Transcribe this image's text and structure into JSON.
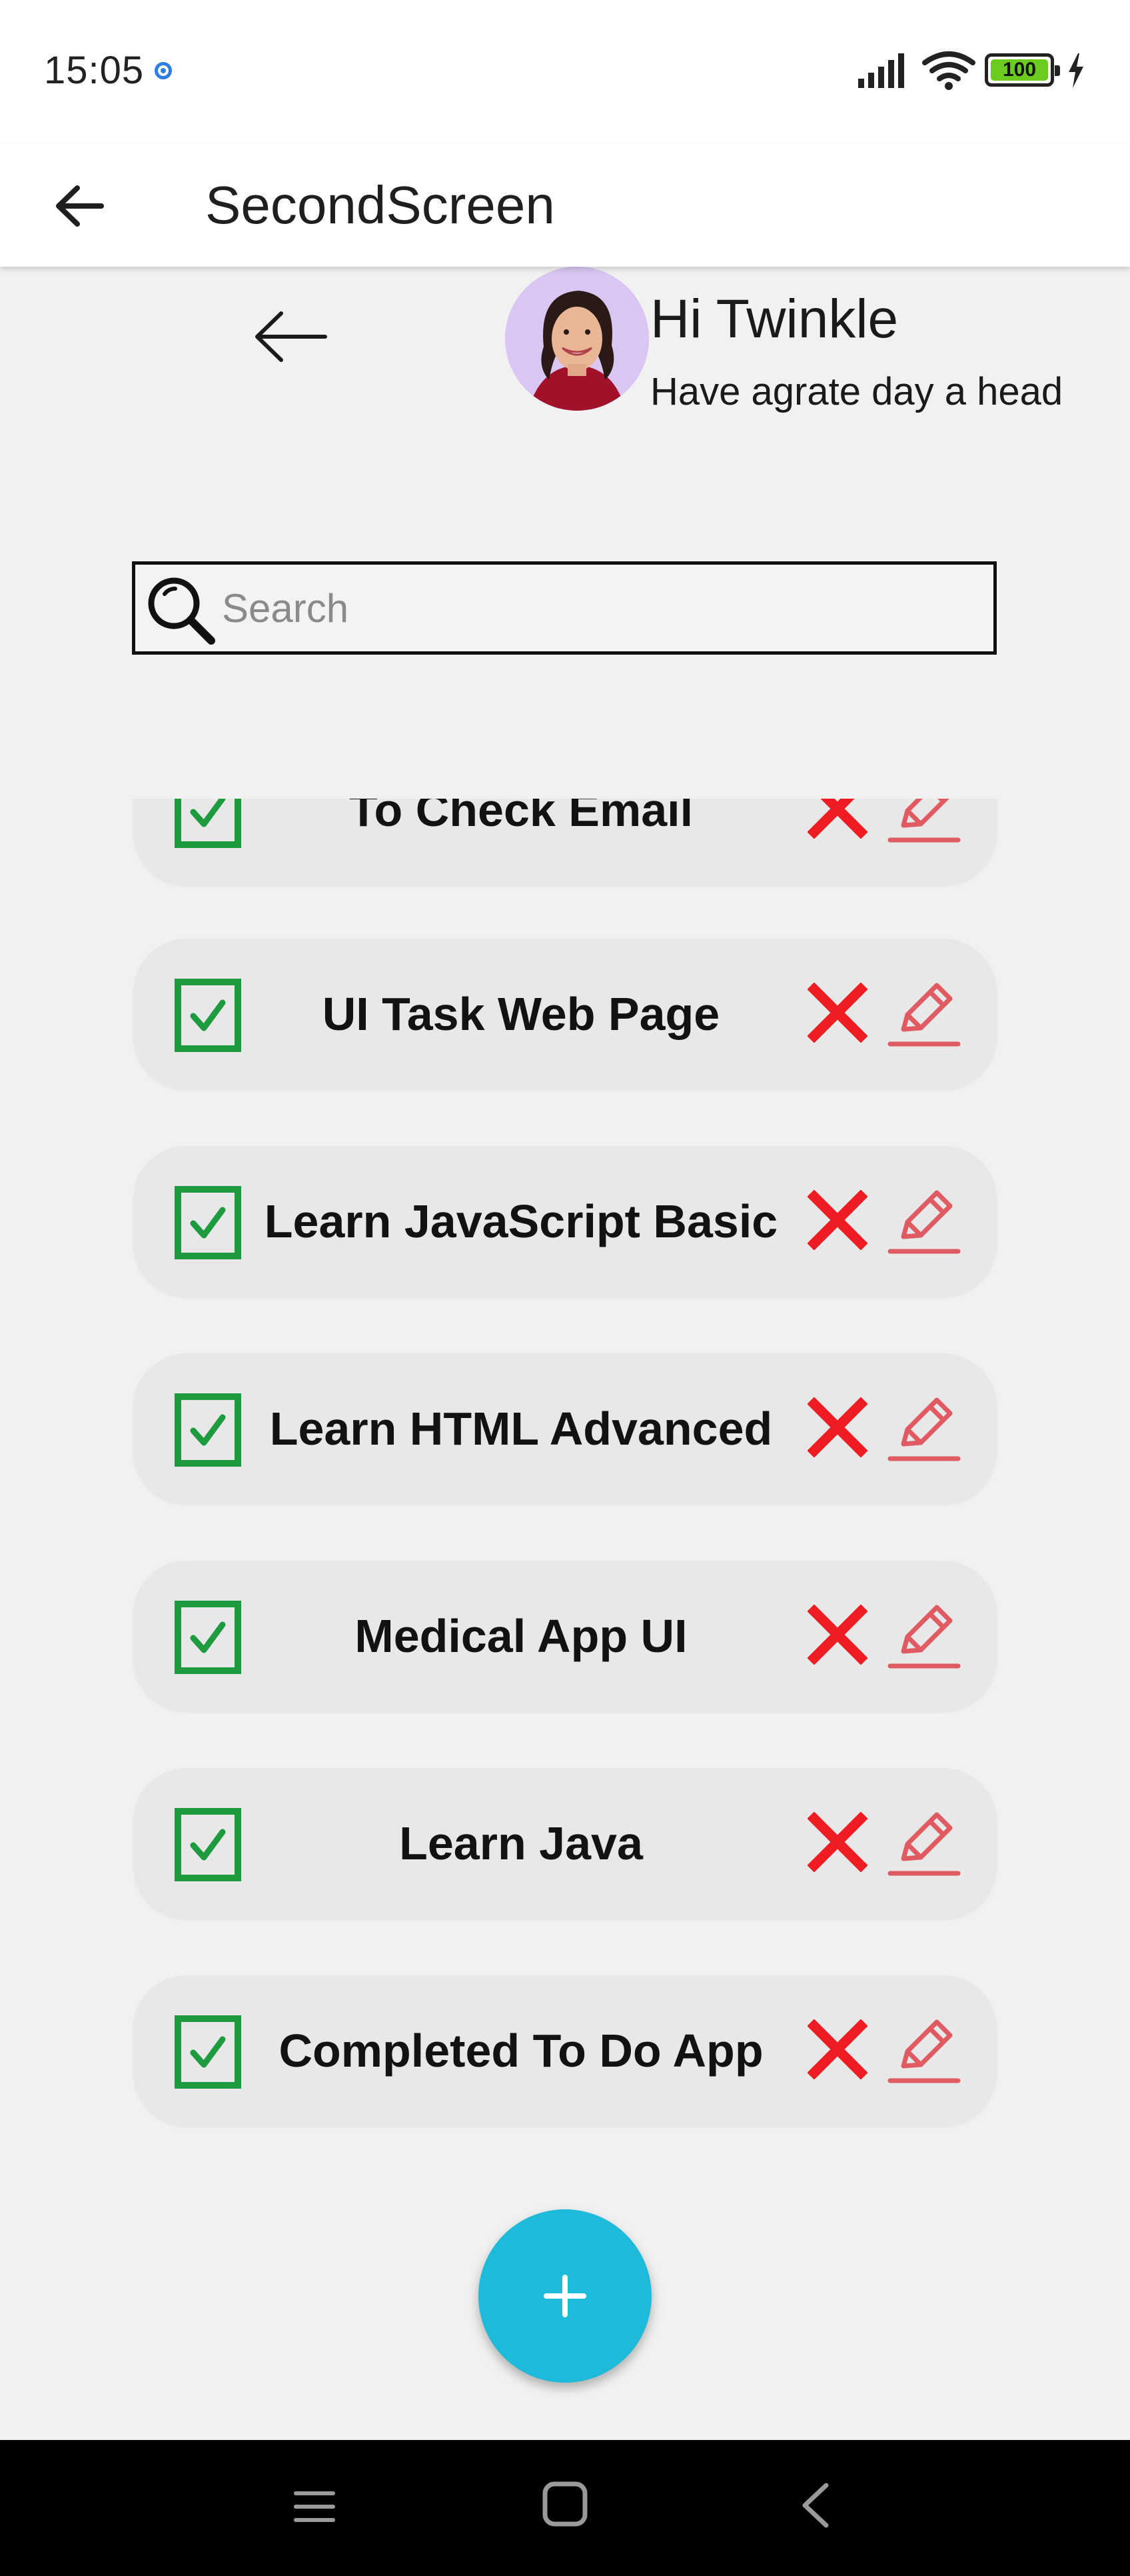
{
  "status_bar": {
    "time": "15:05",
    "battery": "100",
    "icons": [
      "location-icon",
      "signal-icon",
      "wifi-icon",
      "battery-icon",
      "charging-icon"
    ]
  },
  "app_bar": {
    "title": "SecondScreen",
    "back_icon": "arrow-left-icon"
  },
  "header": {
    "greeting": "Hi Twinkle",
    "subgreeting": "Have agrate day a head",
    "back_icon": "arrow-left-icon",
    "avatar": "profile-photo"
  },
  "search": {
    "placeholder": "Search",
    "value": ""
  },
  "tasks": [
    {
      "label": "To Check Email"
    },
    {
      "label": "UI Task Web Page"
    },
    {
      "label": "Learn JavaScript Basic"
    },
    {
      "label": "Learn HTML Advanced"
    },
    {
      "label": "Medical App UI"
    },
    {
      "label": "Learn Java"
    },
    {
      "label": "Completed To Do App"
    }
  ],
  "fab": {
    "label": "+"
  },
  "colors": {
    "check": "#1e9a3f",
    "delete": "#ef1c24",
    "edit": "#e05a62",
    "fab": "#1dbbd9",
    "card": "#e8e8e8",
    "background": "#f1f1f1"
  },
  "nav_bar": {
    "icons": [
      "menu-icon",
      "home-icon",
      "back-icon"
    ]
  }
}
